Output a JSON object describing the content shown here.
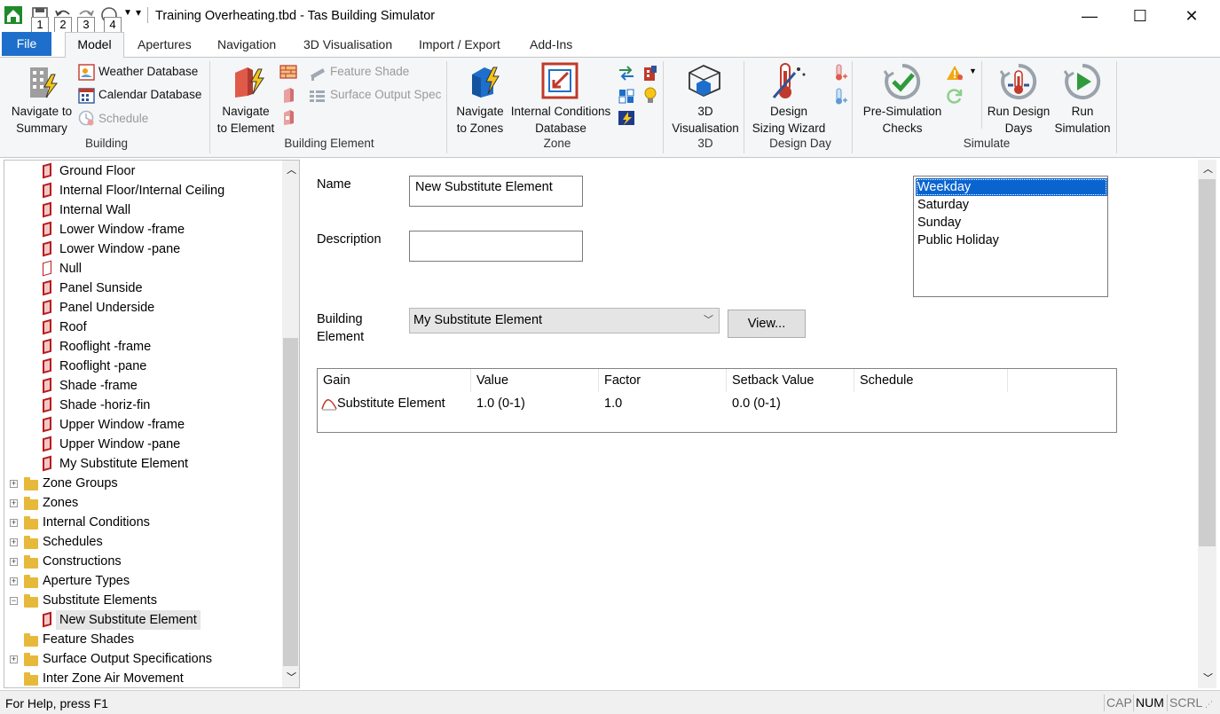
{
  "window": {
    "title": "Training Overheating.tbd - Tas Building Simulator",
    "keytips": [
      "1",
      "2",
      "3",
      "4"
    ],
    "minimize": "—",
    "maximize": "☐",
    "close": "✕"
  },
  "tabs": {
    "file": "File",
    "model": "Model",
    "apertures": "Apertures",
    "navigation": "Navigation",
    "visualisation": "3D Visualisation",
    "import_export": "Import / Export",
    "addins": "Add-Ins"
  },
  "ribbon": {
    "building": {
      "label": "Building",
      "navigate_summary_1": "Navigate to",
      "navigate_summary_2": "Summary",
      "weather_db": "Weather Database",
      "calendar_db": "Calendar Database",
      "schedule": "Schedule"
    },
    "building_element": {
      "label": "Building Element",
      "navigate_element_1": "Navigate",
      "navigate_element_2": "to Element",
      "feature_shade": "Feature Shade",
      "surface_output": "Surface Output Spec"
    },
    "zone": {
      "label": "Zone",
      "navigate_zones_1": "Navigate",
      "navigate_zones_2": "to Zones",
      "internal_conditions_1": "Internal Conditions",
      "internal_conditions_2": "Database"
    },
    "threed": {
      "label": "3D",
      "vis_1": "3D",
      "vis_2": "Visualisation"
    },
    "design_day": {
      "label": "Design Day",
      "sizing_1": "Design",
      "sizing_2": "Sizing Wizard"
    },
    "simulate": {
      "label": "Simulate",
      "presim_1": "Pre-Simulation",
      "presim_2": "Checks",
      "run_design_1": "Run Design",
      "run_design_2": "Days",
      "run_sim_1": "Run",
      "run_sim_2": "Simulation"
    }
  },
  "tree": {
    "elements": [
      "Ground Floor",
      "Internal Floor/Internal Ceiling",
      "Internal Wall",
      "Lower Window -frame",
      "Lower Window -pane",
      "Null",
      "Panel Sunside",
      "Panel Underside",
      "Roof",
      "Rooflight -frame",
      "Rooflight -pane",
      "Shade -frame",
      "Shade -horiz-fin",
      "Upper Window -frame",
      "Upper Window -pane",
      "My Substitute Element"
    ],
    "folders": [
      "Zone Groups",
      "Zones",
      "Internal Conditions",
      "Schedules",
      "Constructions",
      "Aperture Types",
      "Substitute Elements"
    ],
    "selected_child": "New Substitute Element",
    "after_folders": [
      "Feature Shades",
      "Surface Output Specifications",
      "Inter Zone Air Movement"
    ]
  },
  "form": {
    "name_label": "Name",
    "name_value": "New Substitute Element",
    "description_label": "Description",
    "description_value": "",
    "building_element_label_1": "Building",
    "building_element_label_2": "Element",
    "building_element_value": "My Substitute Element",
    "view_button": "View...",
    "days": [
      "Weekday",
      "Saturday",
      "Sunday",
      "Public Holiday"
    ],
    "selected_day": "Weekday"
  },
  "gains_table": {
    "columns": [
      "Gain",
      "Value",
      "Factor",
      "Setback Value",
      "Schedule"
    ],
    "rows": [
      {
        "gain": "Substitute Element",
        "value": "1.0 (0-1)",
        "factor": "1.0",
        "setback": "0.0 (0-1)",
        "schedule": ""
      }
    ]
  },
  "status": {
    "help": "For Help, press F1",
    "cap": "CAP",
    "num": "NUM",
    "scrl": "SCRL"
  },
  "colors": {
    "file_tab": "#1e6fcb",
    "selection": "#0a64d0",
    "element_icon": "#b71c1c",
    "folder_icon": "#e7b93b"
  }
}
